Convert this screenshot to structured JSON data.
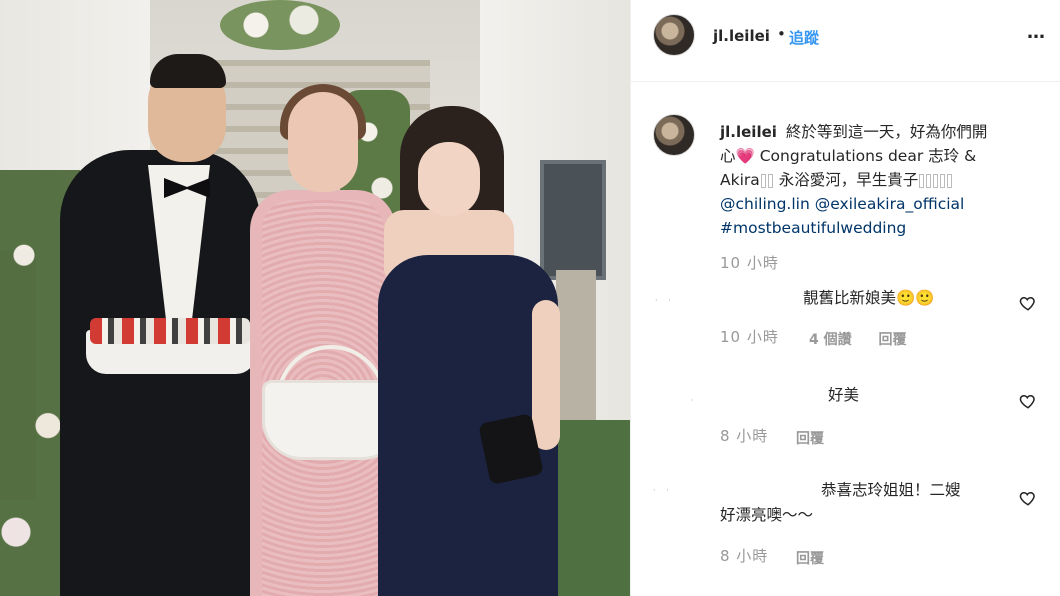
{
  "post": {
    "username": "jl.leilei",
    "separator": "•",
    "follow_label": "追蹤",
    "more_label": "…"
  },
  "caption": {
    "username": "jl.leilei",
    "line1": "終於等到這一天，好為你們開",
    "line2": "心💗 Congratulations dear 志玲 &",
    "line3a": "Akira",
    "line3b": "永浴愛河，早生貴子",
    "mention1": "@chiling.lin",
    "mention2": "@exileakira_official",
    "hashtag": "#mostbeautifulwedding",
    "time": "10 小時"
  },
  "comments": [
    {
      "text": "靚舊比新娘美🙂🙂",
      "time": "10 小時",
      "likes_label": "4 個讚",
      "reply_label": "回覆"
    },
    {
      "text": "好美",
      "time": "8 小時",
      "reply_label": "回覆"
    },
    {
      "text_line1": "恭喜志玲姐姐！二嫂",
      "text_line2": "好漂亮噢～～",
      "time": "8 小時",
      "reply_label": "回覆"
    }
  ],
  "colors": {
    "link": "#003569",
    "follow": "#3897f0",
    "muted": "#999999"
  },
  "icons": {
    "like": "heart-outline-icon",
    "more": "ellipsis-icon"
  }
}
